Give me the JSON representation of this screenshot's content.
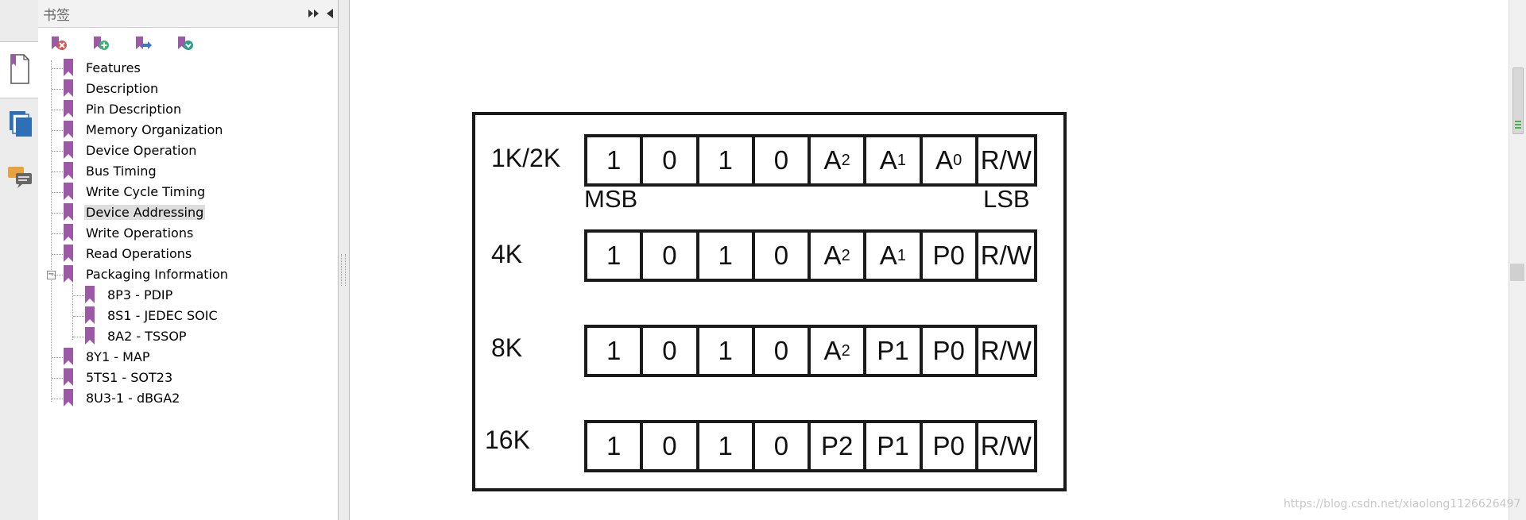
{
  "panel": {
    "title": "书签",
    "toolbar": [
      {
        "name": "delete-bookmark-icon",
        "color": "#d9534f"
      },
      {
        "name": "add-bookmark-icon",
        "color": "#3cb371"
      },
      {
        "name": "move-bookmark-icon",
        "color": "#3a78c3"
      },
      {
        "name": "expand-bookmark-icon",
        "color": "#2e9e8c"
      }
    ],
    "bookmarks": [
      {
        "label": "Features",
        "level": 0
      },
      {
        "label": "Description",
        "level": 0
      },
      {
        "label": "Pin Description",
        "level": 0
      },
      {
        "label": "Memory Organization",
        "level": 0
      },
      {
        "label": "Device Operation",
        "level": 0
      },
      {
        "label": "Bus Timing",
        "level": 0
      },
      {
        "label": "Write Cycle Timing",
        "level": 0
      },
      {
        "label": "Device Addressing",
        "level": 0,
        "selected": true
      },
      {
        "label": "Write Operations",
        "level": 0
      },
      {
        "label": "Read Operations",
        "level": 0
      },
      {
        "label": "Packaging Information",
        "level": 0,
        "expanded": true
      },
      {
        "label": "8P3 - PDIP",
        "level": 1
      },
      {
        "label": "8S1 - JEDEC SOIC",
        "level": 1
      },
      {
        "label": "8A2 - TSSOP",
        "level": 1
      },
      {
        "label": "8Y1 - MAP",
        "level": 0
      },
      {
        "label": "5TS1 - SOT23",
        "level": 0
      },
      {
        "label": "8U3-1 - dBGA2",
        "level": 0
      }
    ],
    "expander_symbol": "−"
  },
  "colors": {
    "bookmark_flag": "#9b59a6",
    "diagram_stroke": "#1a1a1a"
  },
  "diagram": {
    "rows": [
      {
        "label": "1K/2K",
        "cells": [
          [
            "1",
            ""
          ],
          [
            "0",
            ""
          ],
          [
            "1",
            ""
          ],
          [
            "0",
            ""
          ],
          [
            "A",
            "2"
          ],
          [
            "A",
            "1"
          ],
          [
            "A",
            "0"
          ],
          [
            "R/W",
            ""
          ]
        ]
      },
      {
        "label": "4K",
        "cells": [
          [
            "1",
            ""
          ],
          [
            "0",
            ""
          ],
          [
            "1",
            ""
          ],
          [
            "0",
            ""
          ],
          [
            "A",
            "2"
          ],
          [
            "A",
            "1"
          ],
          [
            "P0",
            ""
          ],
          [
            "R/W",
            ""
          ]
        ]
      },
      {
        "label": "8K",
        "cells": [
          [
            "1",
            ""
          ],
          [
            "0",
            ""
          ],
          [
            "1",
            ""
          ],
          [
            "0",
            ""
          ],
          [
            "A",
            "2"
          ],
          [
            "P1",
            ""
          ],
          [
            "P0",
            ""
          ],
          [
            "R/W",
            ""
          ]
        ]
      },
      {
        "label": "16K",
        "cells": [
          [
            "1",
            ""
          ],
          [
            "0",
            ""
          ],
          [
            "1",
            ""
          ],
          [
            "0",
            ""
          ],
          [
            "P2",
            ""
          ],
          [
            "P1",
            ""
          ],
          [
            "P0",
            ""
          ],
          [
            "R/W",
            ""
          ]
        ]
      }
    ],
    "msb": "MSB",
    "lsb": "LSB"
  },
  "watermark": "https://blog.csdn.net/xiaolong1126626497"
}
